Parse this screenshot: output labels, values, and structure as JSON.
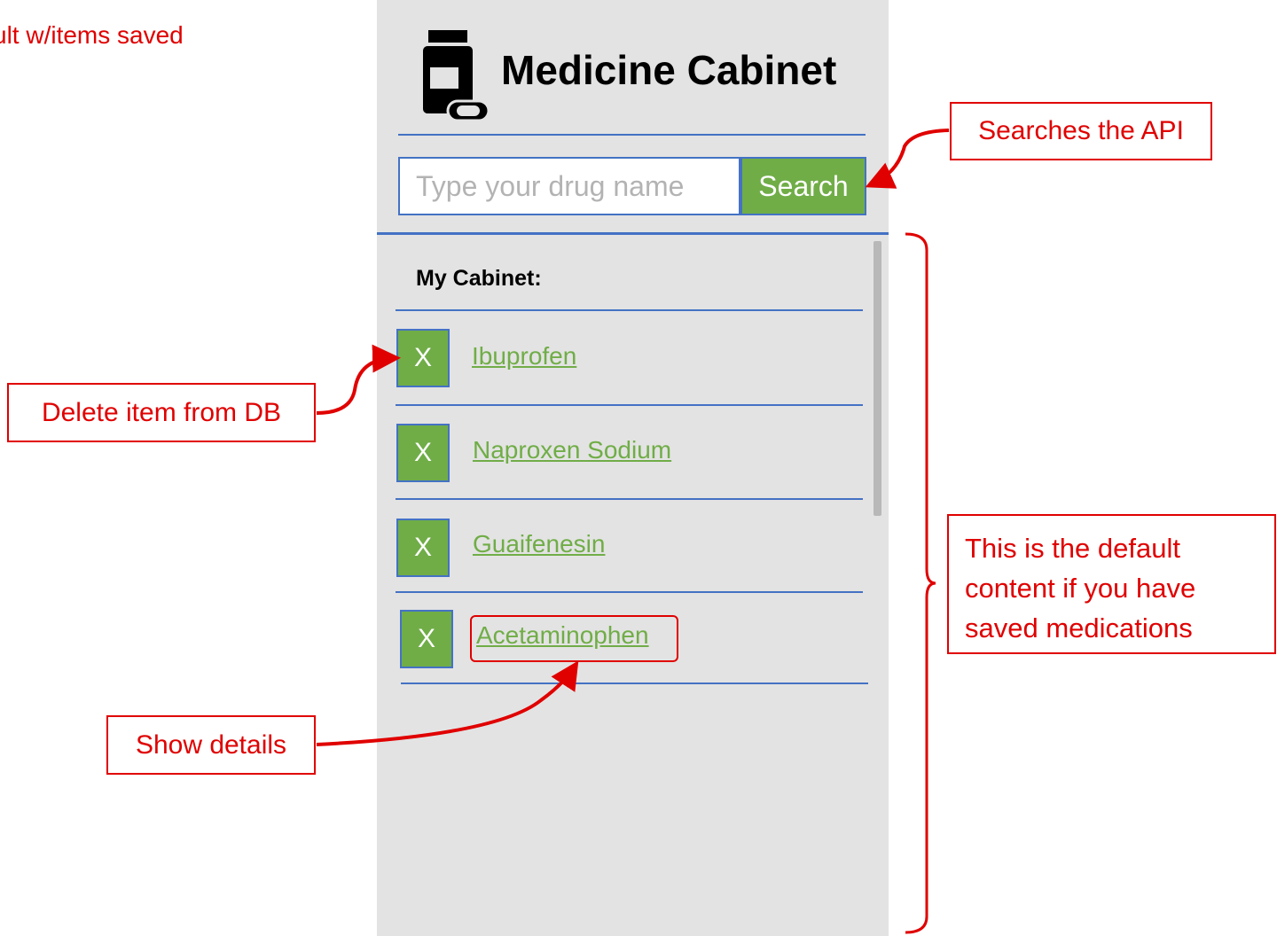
{
  "annotations": {
    "corner_note": "ult w/items saved",
    "search": "Searches the API",
    "delete": "Delete item from DB",
    "details": "Show details",
    "default_line1": "This is the default",
    "default_line2": "content if you have",
    "default_line3": "saved medications"
  },
  "app": {
    "title": "Medicine Cabinet",
    "icon": "medicine-bottle-icon"
  },
  "search": {
    "placeholder": "Type your drug name",
    "value": "",
    "button_label": "Search"
  },
  "cabinet": {
    "heading": "My Cabinet:",
    "delete_label": "X",
    "items": [
      {
        "name": "Ibuprofen"
      },
      {
        "name": "Naproxen Sodium"
      },
      {
        "name": "Guaifenesin"
      },
      {
        "name": "Acetaminophen"
      }
    ]
  },
  "colors": {
    "accent_green": "#70ad47",
    "rule_blue": "#4472c4",
    "annotation_red": "#e00000",
    "panel_gray": "#e3e3e3"
  }
}
